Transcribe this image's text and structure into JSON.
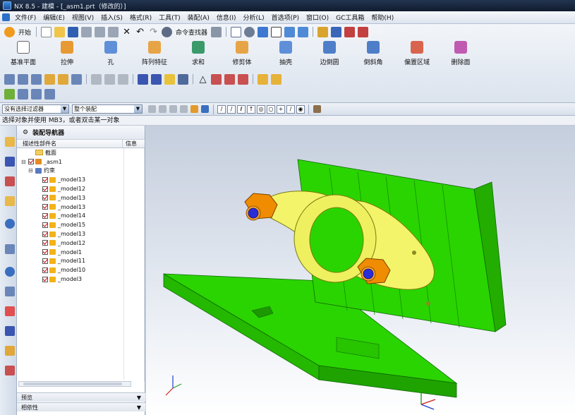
{
  "window": {
    "title": "NX 8.5 - 建模 - [_asm1.prt（修改的）]"
  },
  "menu": {
    "items": [
      "文件(F)",
      "编辑(E)",
      "视图(V)",
      "插入(S)",
      "格式(R)",
      "工具(T)",
      "装配(A)",
      "信息(I)",
      "分析(L)",
      "首选项(P)",
      "窗口(O)",
      "GC工具箱",
      "帮助(H)"
    ]
  },
  "toolbar": {
    "start_label": "开始",
    "command_finder_label": "命令查找器"
  },
  "ribbon": {
    "buttons": [
      "基准平面",
      "拉伸",
      "孔",
      "阵列特征",
      "求和",
      "修剪体",
      "抽壳",
      "边倒圆",
      "倒斜角",
      "偏置区域",
      "删除面"
    ]
  },
  "filterbar": {
    "type_filter": "没有选择过滤器",
    "scope": "整个装配"
  },
  "status": {
    "prompt": "选择对象并使用 MB3，或者双击某一对象"
  },
  "navigator": {
    "title": "装配导航器",
    "columns": [
      "描述性部件名",
      "信息"
    ],
    "rows": [
      {
        "label": "截面",
        "level": 1,
        "kind": "folder"
      },
      {
        "label": "_asm1",
        "level": 0,
        "kind": "assembly"
      },
      {
        "label": "约束",
        "level": 1,
        "kind": "constraint"
      },
      {
        "label": "_model13",
        "level": 2,
        "kind": "part"
      },
      {
        "label": "_model12",
        "level": 2,
        "kind": "part"
      },
      {
        "label": "_model13",
        "level": 2,
        "kind": "part"
      },
      {
        "label": "_model13",
        "level": 2,
        "kind": "part"
      },
      {
        "label": "_model14",
        "level": 2,
        "kind": "part"
      },
      {
        "label": "_model15",
        "level": 2,
        "kind": "part"
      },
      {
        "label": "_model13",
        "level": 2,
        "kind": "part"
      },
      {
        "label": "_model12",
        "level": 2,
        "kind": "part"
      },
      {
        "label": "_model1",
        "level": 2,
        "kind": "part"
      },
      {
        "label": "_model11",
        "level": 2,
        "kind": "part"
      },
      {
        "label": "_model10",
        "level": 2,
        "kind": "part"
      },
      {
        "label": "_model3",
        "level": 2,
        "kind": "part"
      }
    ],
    "footer": [
      "预览",
      "相依性"
    ]
  },
  "colors": {
    "base_green": "#2ad400",
    "clamp_yellow": "#f4f46a",
    "nut_orange": "#f08c00",
    "bolt_blue": "#2a2cd8"
  }
}
